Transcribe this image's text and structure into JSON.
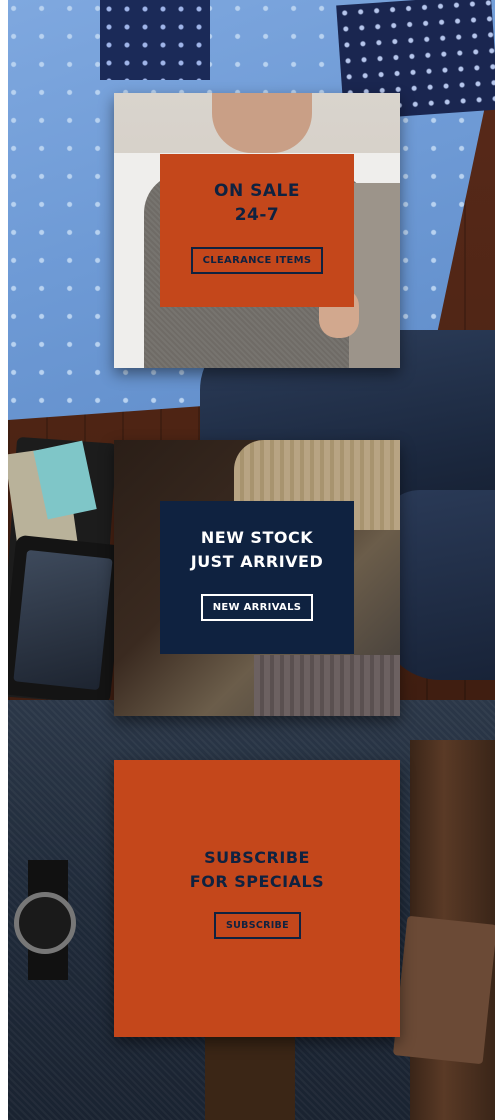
{
  "promos": [
    {
      "headline_line1": "ON SALE",
      "headline_line2": "24-7",
      "button_label": "CLEARANCE ITEMS"
    },
    {
      "headline_line1": "NEW STOCK",
      "headline_line2": "JUST ARRIVED",
      "button_label": "NEW ARRIVALS"
    },
    {
      "headline_line1": "SUBSCRIBE",
      "headline_line2": "FOR SPECIALS",
      "button_label": "SUBSCRIBE"
    }
  ],
  "colors": {
    "accent_orange": "#c4471b",
    "navy": "#0f2240",
    "white": "#ffffff"
  }
}
